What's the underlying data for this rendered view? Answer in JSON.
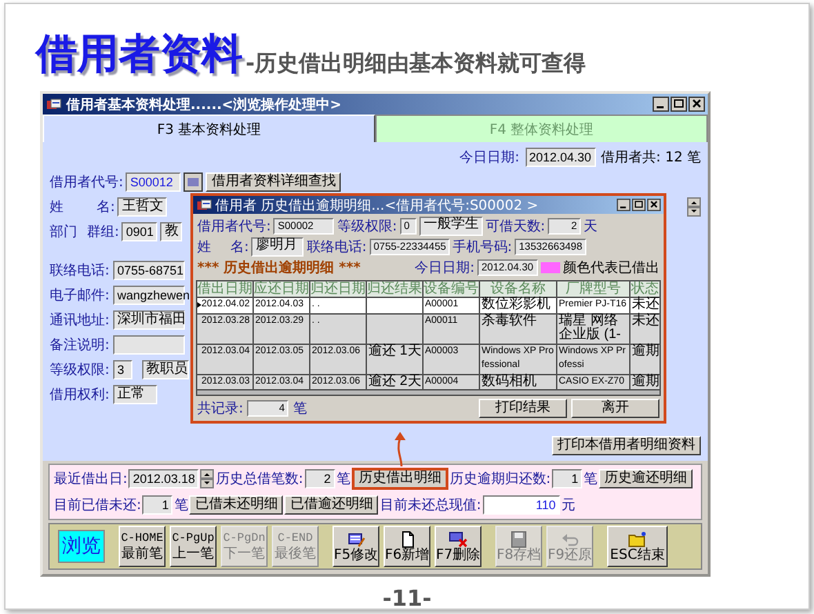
{
  "slide": {
    "title": "借用者资料",
    "subtitle": "-历史借出明细由基本资料就可查得",
    "page_number": "-11-"
  },
  "window": {
    "title": "借用者基本资料处理......<浏览操作处理中>"
  },
  "tabs": [
    {
      "label": "F3 基本资料处理",
      "selected": true
    },
    {
      "label": "F4 整体资料处理",
      "selected": false
    }
  ],
  "header": {
    "today_label": "今日日期:",
    "today": "2012.04.30",
    "count_text": "借用者共: 12 笔"
  },
  "borrower": {
    "code_label": "借用者代号:",
    "code": "S00012",
    "search_button": "借用者资料详细查找",
    "name_label_1": "姓",
    "name_label_2": "名:",
    "name": "王哲文",
    "dept_label": "部门",
    "group_label": "群组:",
    "group_code": "0901",
    "group_name": "教"
  },
  "details": [
    {
      "label": "联络电话:",
      "value": "0755-68751"
    },
    {
      "label": "电子邮件:",
      "value": "wangzhewen"
    },
    {
      "label": "通讯地址:",
      "value": "深圳市福田"
    },
    {
      "label": "备注说明:"
    }
  ],
  "level": {
    "label": "等级权限:",
    "code": "3",
    "name": "教职员"
  },
  "rights": {
    "label": "借用权利:",
    "value": "正常"
  },
  "print_button": "打印本借用者明细资料",
  "summary": [
    {
      "items": [
        {
          "kind": "label",
          "text": "最近借出日:"
        },
        {
          "kind": "date",
          "text": "2012.03.18"
        },
        {
          "kind": "label",
          "text": "历史总借笔数:"
        },
        {
          "kind": "count",
          "text": "2"
        },
        {
          "kind": "unit",
          "text": "笔"
        },
        {
          "kind": "button",
          "text": "历史借出明细",
          "highlighted": true
        },
        {
          "kind": "label",
          "text": "历史逾期归还数:"
        },
        {
          "kind": "count",
          "text": "1"
        },
        {
          "kind": "unit",
          "text": "笔"
        },
        {
          "kind": "button",
          "text": "历史逾还明细",
          "highlighted": false
        }
      ]
    },
    {
      "items": [
        {
          "kind": "label",
          "text": "目前已借未还:"
        },
        {
          "kind": "count",
          "text": "1"
        },
        {
          "kind": "unit",
          "text": "笔"
        },
        {
          "kind": "button",
          "text": "已借未还明细",
          "highlighted": false
        },
        {
          "kind": "button",
          "text": "已借逾还明细",
          "highlighted": false
        },
        {
          "kind": "label",
          "text": "目前未还总现值:"
        },
        {
          "kind": "amount",
          "text": "110"
        },
        {
          "kind": "unit",
          "text": "元"
        }
      ]
    }
  ],
  "toolbar": [
    {
      "buttons": [
        {
          "kind": "mode",
          "lines": [
            "浏览"
          ]
        }
      ]
    },
    {
      "buttons": [
        {
          "kind": "nav",
          "lines": [
            "C-HOME",
            "最前笔"
          ],
          "disabled": false
        },
        {
          "kind": "nav",
          "lines": [
            "C-PgUp",
            "上一笔"
          ],
          "disabled": false
        },
        {
          "kind": "nav",
          "lines": [
            "C-PgDn",
            "下一笔"
          ],
          "disabled": true
        },
        {
          "kind": "nav",
          "lines": [
            "C-END",
            "最後笔"
          ],
          "disabled": true
        }
      ]
    },
    {
      "buttons": [
        {
          "kind": "edit",
          "lines": [
            "F5修改"
          ],
          "disabled": false
        },
        {
          "kind": "new",
          "lines": [
            "F6新增"
          ],
          "disabled": false
        },
        {
          "kind": "delete",
          "lines": [
            "F7删除"
          ],
          "disabled": false
        }
      ]
    },
    {
      "buttons": [
        {
          "kind": "save",
          "lines": [
            "F8存档"
          ],
          "disabled": true
        },
        {
          "kind": "undo",
          "lines": [
            "F9还原"
          ],
          "disabled": true
        }
      ]
    },
    {
      "buttons": [
        {
          "kind": "exit",
          "lines": [
            "ESC结束"
          ],
          "disabled": false
        }
      ]
    }
  ],
  "popup": {
    "title": "借用者 历史借出逾期明细...<借用者代号:S00002   >",
    "code_label": "借用者代号:",
    "code": "S00002",
    "level_label": "等级权限:",
    "level_code": "0",
    "level_name": "一般学生",
    "days_label": "可借天数:",
    "days": "2",
    "days_unit": "天",
    "name_label_1": "姓",
    "name_label_2": "名:",
    "name": "廖明月",
    "phone_label": "联络电话:",
    "phone": "0755-22334455",
    "mobile_label": "手机号码:",
    "mobile": "13532663498",
    "section_title": "*** 历史借出逾期明细 ***",
    "today_label": "今日日期:",
    "today": "2012.04.30",
    "legend_label": "颜色代表已借出",
    "table": {
      "columns": [
        "借出日期",
        "应还日期",
        "归还日期",
        "归还结果",
        "设备编号",
        "设备名称",
        "厂牌型号",
        "状态"
      ],
      "rows": [
        {
          "selected": true,
          "cells": [
            "2012.04.02",
            "2012.04.03",
            ". .",
            null,
            "A00001",
            "数位彩影机",
            "Premier PJ-T16",
            "未还"
          ]
        },
        {
          "selected": false,
          "cells": [
            "2012.03.28",
            "2012.03.29",
            ". .",
            null,
            "A00011",
            "杀毒软件",
            "瑞星 网络企业版 (1-",
            "未还"
          ]
        },
        {
          "selected": false,
          "cells": [
            "2012.03.04",
            "2012.03.05",
            "2012.03.06",
            "逾还 1天",
            "A00003",
            "Windows XP Professional",
            "Windows XP Professi",
            "逾期"
          ]
        },
        {
          "selected": false,
          "cells": [
            "2012.03.03",
            "2012.03.04",
            "2012.03.06",
            "逾还 2天",
            "A00004",
            "数码相机",
            "CASIO EX-Z70",
            "逾期"
          ]
        }
      ]
    },
    "count_label": "共记录:",
    "count": "4",
    "count_unit": "笔",
    "buttons": [
      "打印结果",
      "离开"
    ]
  }
}
